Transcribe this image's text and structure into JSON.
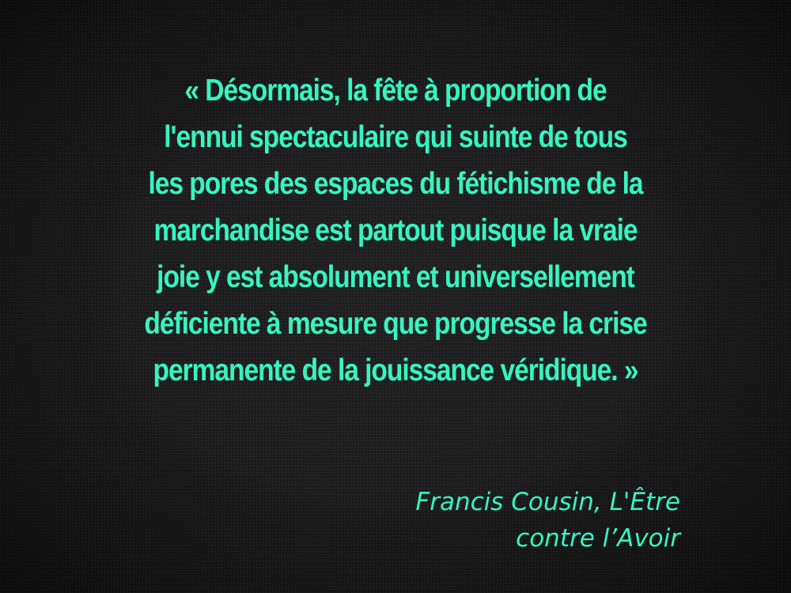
{
  "quote": {
    "lines": [
      "« Désormais, la fête à proportion de",
      "l'ennui spectaculaire qui suinte de tous",
      "les pores des espaces du fétichisme de la",
      "marchandise est partout puisque la vraie",
      "joie y est absolument et universellement",
      "déficiente à mesure que progresse la crise",
      "permanente de la jouissance véridique. »"
    ]
  },
  "attribution": {
    "lines": [
      "Francis Cousin, L'Être",
      "contre l’Avoir"
    ]
  },
  "colors": {
    "text": "#36f5c0",
    "background": "#1a1a1a"
  }
}
